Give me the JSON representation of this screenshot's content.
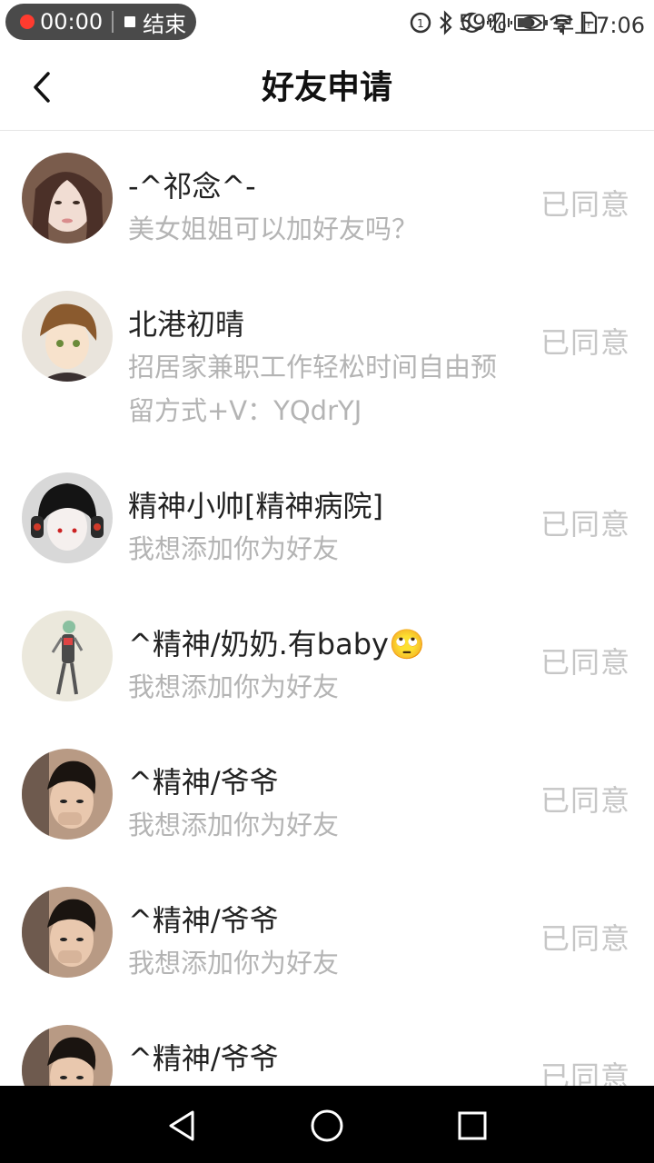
{
  "status_bar": {
    "recording_time": "00:00",
    "end_label": "结束",
    "battery": "59%",
    "battery_level": 0.59,
    "time": "早上7:06",
    "icons": [
      "hd-icon",
      "bluetooth-icon",
      "moon-icon",
      "vibrate-icon",
      "eye-icon",
      "wifi-icon",
      "sim-icon",
      "battery-icon"
    ]
  },
  "header": {
    "title": "好友申请",
    "back_icon": "chevron-left-icon"
  },
  "requests": [
    {
      "name": "-^祁念^-",
      "message": "美女姐姐可以加好友吗？",
      "status": "已同意"
    },
    {
      "name": "北港初晴",
      "message": "招居家兼职工作轻松时间自由预留方式+V：YQdrYJ",
      "status": "已同意"
    },
    {
      "name": "精神小帅[精神病院]",
      "message": "我想添加你为好友",
      "status": "已同意"
    },
    {
      "name": "^精神/奶奶.有baby🙄",
      "message": "我想添加你为好友",
      "status": "已同意"
    },
    {
      "name": "^精神/爷爷",
      "message": "我想添加你为好友",
      "status": "已同意"
    },
    {
      "name": "^精神/爷爷",
      "message": "我想添加你为好友",
      "status": "已同意"
    },
    {
      "name": "^精神/爷爷",
      "message": "",
      "status": "已同意"
    }
  ],
  "nav": [
    "back-triangle-icon",
    "home-circle-icon",
    "recents-square-icon"
  ]
}
